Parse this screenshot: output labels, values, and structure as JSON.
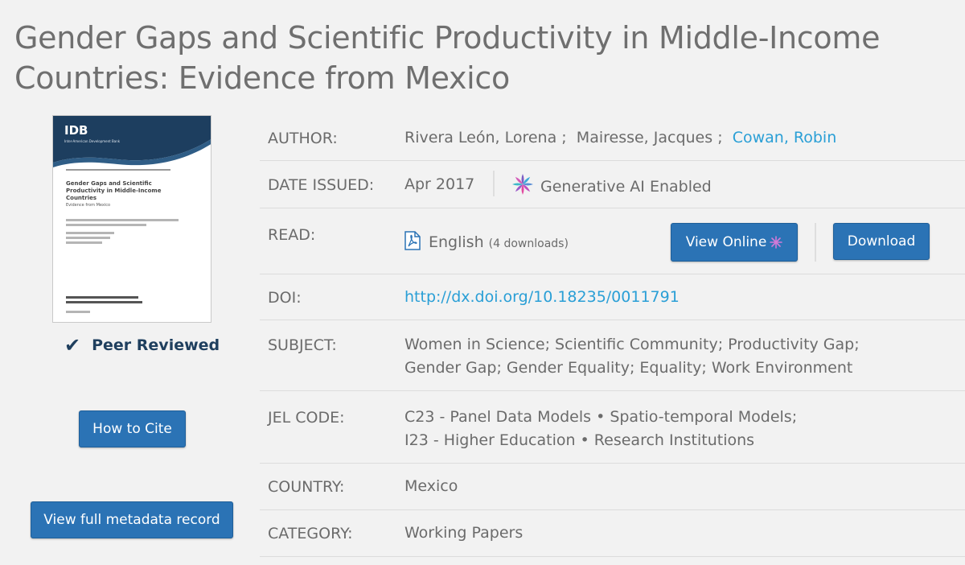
{
  "title": "Gender Gaps and Scientific Productivity in Middle-Income Countries: Evidence from Mexico",
  "thumbnail": {
    "logo": "IDB",
    "logo_sub": "Inter-American Development Bank",
    "doc_title": "Gender Gaps and Scientific Productivity in Middle-Income Countries",
    "doc_subtitle": "Evidence from Mexico"
  },
  "peer_reviewed_label": "Peer Reviewed",
  "buttons": {
    "how_to_cite": "How to Cite",
    "view_full_metadata": "View full metadata record",
    "view_online": "View Online",
    "download": "Download"
  },
  "fields": {
    "author": {
      "label": "AUTHOR:",
      "authors": [
        "Rivera León, Lorena",
        "Mairesse, Jacques",
        "Cowan, Robin"
      ],
      "separator": " ;"
    },
    "date_issued": {
      "label": "DATE ISSUED:",
      "value": "Apr 2017",
      "ai_label": "Generative AI Enabled"
    },
    "read": {
      "label": "READ:",
      "language": "English",
      "downloads": "(4 downloads)"
    },
    "doi": {
      "label": "DOI:",
      "value": "http://dx.doi.org/10.18235/0011791"
    },
    "subject": {
      "label": "SUBJECT:",
      "line1": "Women in Science;  Scientific Community;  Productivity Gap;",
      "line2": "Gender Gap;  Gender Equality;  Equality;  Work Environment"
    },
    "jel_code": {
      "label": "JEL CODE:",
      "line1": "C23 - Panel Data Models • Spatio-temporal Models;",
      "line2": "I23 - Higher Education • Research Institutions"
    },
    "country": {
      "label": "COUNTRY:",
      "value": "Mexico"
    },
    "category": {
      "label": "CATEGORY:",
      "value": "Working Papers"
    }
  },
  "colors": {
    "link": "#2a9fd6",
    "button": "#2b73b5",
    "peer_reviewed": "#1f3f5e",
    "text": "#6b6b6b",
    "background": "#f2f2f2"
  }
}
